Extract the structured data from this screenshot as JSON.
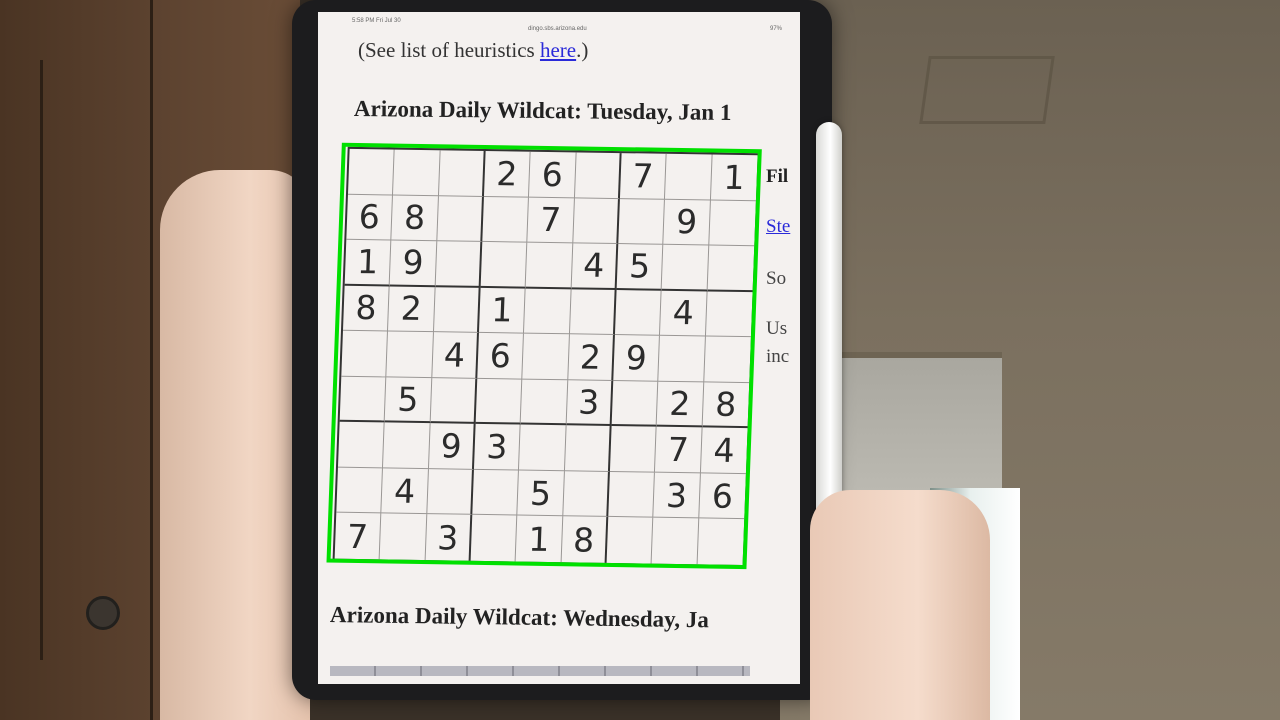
{
  "page": {
    "status_time": "5:58 PM  Fri Jul 30",
    "status_url": "dingo.sbs.arizona.edu",
    "status_battery": "97%",
    "heuristics_prefix": "(See list of heuristics ",
    "heuristics_link": "here",
    "heuristics_suffix": ".)",
    "heading_tuesday": "Arizona Daily Wildcat: Tuesday, Jan 1",
    "heading_wednesday": "Arizona Daily Wildcat: Wednesday, Ja",
    "side_fil": "Fil",
    "side_ste": "Ste",
    "side_so": "So",
    "side_us": "Us",
    "side_inc": "inc"
  },
  "sudoku": {
    "rows": [
      [
        "",
        "",
        "",
        "2",
        "6",
        "",
        "7",
        "",
        "1"
      ],
      [
        "6",
        "8",
        "",
        "",
        "7",
        "",
        "",
        "9",
        ""
      ],
      [
        "1",
        "9",
        "",
        "",
        "",
        "4",
        "5",
        "",
        ""
      ],
      [
        "8",
        "2",
        "",
        "1",
        "",
        "",
        "",
        "4",
        ""
      ],
      [
        "",
        "",
        "4",
        "6",
        "",
        "2",
        "9",
        "",
        ""
      ],
      [
        "",
        "5",
        "",
        "",
        "",
        "3",
        "",
        "2",
        "8"
      ],
      [
        "",
        "",
        "9",
        "3",
        "",
        "",
        "",
        "7",
        "4"
      ],
      [
        "",
        "4",
        "",
        "",
        "5",
        "",
        "",
        "3",
        "6"
      ],
      [
        "7",
        "",
        "3",
        "",
        "1",
        "8",
        "",
        "",
        ""
      ]
    ]
  },
  "colors": {
    "highlight": "#00e000",
    "link": "#2a2ad9"
  }
}
